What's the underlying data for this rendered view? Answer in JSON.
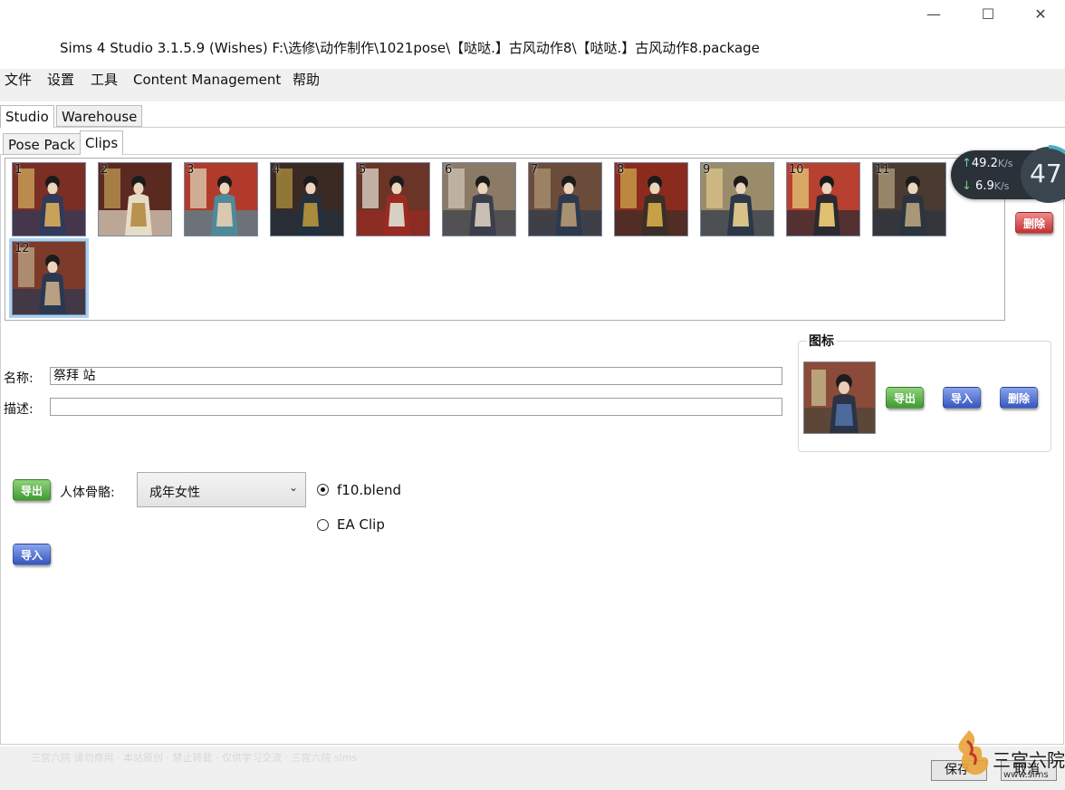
{
  "window": {
    "title": "Sims 4 Studio 3.1.5.9 (Wishes)  F:\\选修\\动作制作\\1021pose\\【哒哒.】古风动作8\\【哒哒.】古风动作8.package",
    "minimize_glyph": "—",
    "maximize_glyph": "☐",
    "close_glyph": "✕"
  },
  "menu": {
    "items": [
      "文件",
      "设置",
      "工具",
      "Content Management",
      "帮助"
    ]
  },
  "top_tabs": [
    {
      "label": "Studio",
      "active": true
    },
    {
      "label": "Warehouse",
      "active": false
    }
  ],
  "sub_tabs": [
    {
      "label": "Pose Pack",
      "active": false
    },
    {
      "label": "Clips",
      "active": true
    }
  ],
  "clips": {
    "thumbnails": [
      {
        "number": "1"
      },
      {
        "number": "2"
      },
      {
        "number": "3"
      },
      {
        "number": "4"
      },
      {
        "number": "5"
      },
      {
        "number": "6"
      },
      {
        "number": "7"
      },
      {
        "number": "8"
      },
      {
        "number": "9"
      },
      {
        "number": "10"
      },
      {
        "number": "11"
      },
      {
        "number": "12",
        "selected": true
      }
    ],
    "delete_label": "删除"
  },
  "form": {
    "name_label": "名称:",
    "name_value": "祭拜 站",
    "desc_label": "描述:",
    "desc_value": ""
  },
  "icon_group": {
    "title": "图标",
    "export_label": "导出",
    "import_label": "导入",
    "delete_label": "删除"
  },
  "animation": {
    "export_label": "导出",
    "import_label": "导入",
    "skeleton_label": "人体骨骼:",
    "skeleton_value": "成年女性",
    "radio_options": [
      {
        "label": "f10.blend",
        "checked": true
      },
      {
        "label": "EA Clip",
        "checked": false
      }
    ]
  },
  "net_monitor": {
    "upload": "49.2",
    "download": "6.9",
    "unit": "K/s",
    "cpu_value": "47"
  },
  "bottom": {
    "save_label": "保存",
    "cancel_label": "取消",
    "status_text": "三宫六院 请勿商用 · 本站原创 · 禁止转载 · 仅供学习交流 · 三宫六院 sims"
  },
  "watermark": {
    "text": "三宫六院",
    "url": "www.sims"
  },
  "colors": {
    "green_button": "#3f9a33",
    "blue_button": "#3556bf",
    "red_button": "#c23232",
    "selection": "#a9d1f2"
  }
}
